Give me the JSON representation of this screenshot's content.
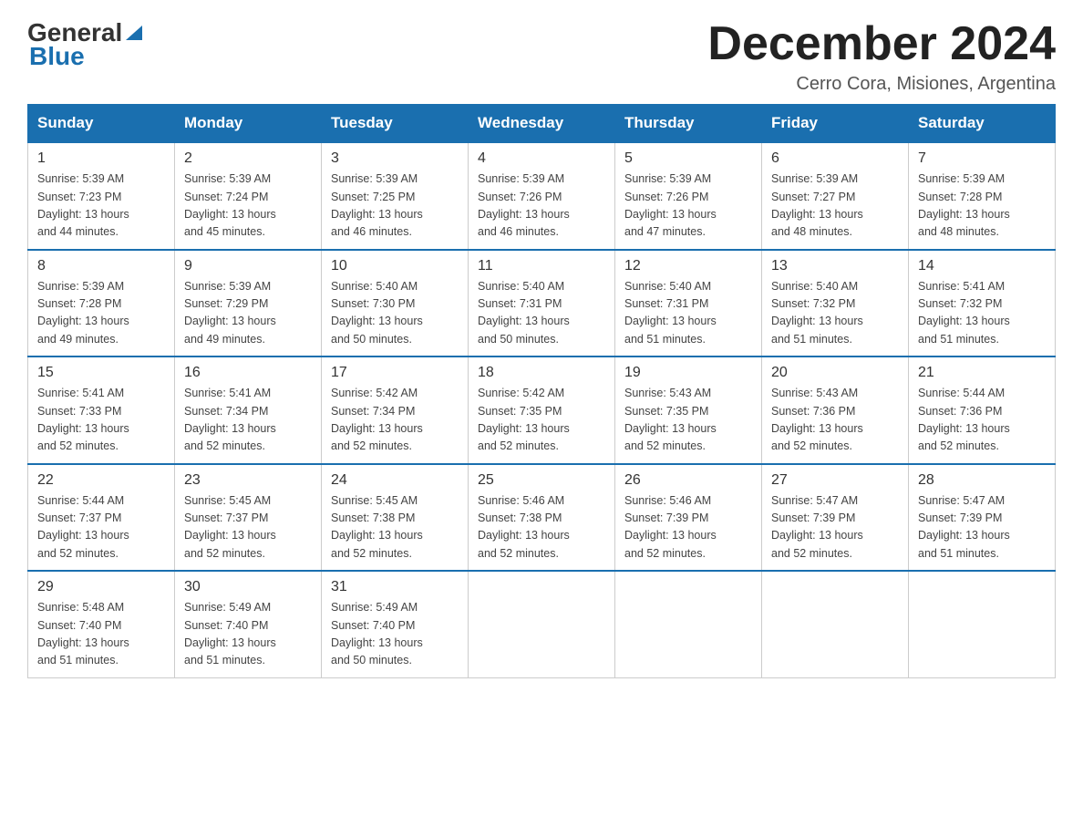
{
  "header": {
    "logo_general": "General",
    "logo_blue": "Blue",
    "title": "December 2024",
    "subtitle": "Cerro Cora, Misiones, Argentina"
  },
  "days_of_week": [
    "Sunday",
    "Monday",
    "Tuesday",
    "Wednesday",
    "Thursday",
    "Friday",
    "Saturday"
  ],
  "weeks": [
    [
      {
        "day": "1",
        "sunrise": "5:39 AM",
        "sunset": "7:23 PM",
        "daylight": "13 hours and 44 minutes."
      },
      {
        "day": "2",
        "sunrise": "5:39 AM",
        "sunset": "7:24 PM",
        "daylight": "13 hours and 45 minutes."
      },
      {
        "day": "3",
        "sunrise": "5:39 AM",
        "sunset": "7:25 PM",
        "daylight": "13 hours and 46 minutes."
      },
      {
        "day": "4",
        "sunrise": "5:39 AM",
        "sunset": "7:26 PM",
        "daylight": "13 hours and 46 minutes."
      },
      {
        "day": "5",
        "sunrise": "5:39 AM",
        "sunset": "7:26 PM",
        "daylight": "13 hours and 47 minutes."
      },
      {
        "day": "6",
        "sunrise": "5:39 AM",
        "sunset": "7:27 PM",
        "daylight": "13 hours and 48 minutes."
      },
      {
        "day": "7",
        "sunrise": "5:39 AM",
        "sunset": "7:28 PM",
        "daylight": "13 hours and 48 minutes."
      }
    ],
    [
      {
        "day": "8",
        "sunrise": "5:39 AM",
        "sunset": "7:28 PM",
        "daylight": "13 hours and 49 minutes."
      },
      {
        "day": "9",
        "sunrise": "5:39 AM",
        "sunset": "7:29 PM",
        "daylight": "13 hours and 49 minutes."
      },
      {
        "day": "10",
        "sunrise": "5:40 AM",
        "sunset": "7:30 PM",
        "daylight": "13 hours and 50 minutes."
      },
      {
        "day": "11",
        "sunrise": "5:40 AM",
        "sunset": "7:31 PM",
        "daylight": "13 hours and 50 minutes."
      },
      {
        "day": "12",
        "sunrise": "5:40 AM",
        "sunset": "7:31 PM",
        "daylight": "13 hours and 51 minutes."
      },
      {
        "day": "13",
        "sunrise": "5:40 AM",
        "sunset": "7:32 PM",
        "daylight": "13 hours and 51 minutes."
      },
      {
        "day": "14",
        "sunrise": "5:41 AM",
        "sunset": "7:32 PM",
        "daylight": "13 hours and 51 minutes."
      }
    ],
    [
      {
        "day": "15",
        "sunrise": "5:41 AM",
        "sunset": "7:33 PM",
        "daylight": "13 hours and 52 minutes."
      },
      {
        "day": "16",
        "sunrise": "5:41 AM",
        "sunset": "7:34 PM",
        "daylight": "13 hours and 52 minutes."
      },
      {
        "day": "17",
        "sunrise": "5:42 AM",
        "sunset": "7:34 PM",
        "daylight": "13 hours and 52 minutes."
      },
      {
        "day": "18",
        "sunrise": "5:42 AM",
        "sunset": "7:35 PM",
        "daylight": "13 hours and 52 minutes."
      },
      {
        "day": "19",
        "sunrise": "5:43 AM",
        "sunset": "7:35 PM",
        "daylight": "13 hours and 52 minutes."
      },
      {
        "day": "20",
        "sunrise": "5:43 AM",
        "sunset": "7:36 PM",
        "daylight": "13 hours and 52 minutes."
      },
      {
        "day": "21",
        "sunrise": "5:44 AM",
        "sunset": "7:36 PM",
        "daylight": "13 hours and 52 minutes."
      }
    ],
    [
      {
        "day": "22",
        "sunrise": "5:44 AM",
        "sunset": "7:37 PM",
        "daylight": "13 hours and 52 minutes."
      },
      {
        "day": "23",
        "sunrise": "5:45 AM",
        "sunset": "7:37 PM",
        "daylight": "13 hours and 52 minutes."
      },
      {
        "day": "24",
        "sunrise": "5:45 AM",
        "sunset": "7:38 PM",
        "daylight": "13 hours and 52 minutes."
      },
      {
        "day": "25",
        "sunrise": "5:46 AM",
        "sunset": "7:38 PM",
        "daylight": "13 hours and 52 minutes."
      },
      {
        "day": "26",
        "sunrise": "5:46 AM",
        "sunset": "7:39 PM",
        "daylight": "13 hours and 52 minutes."
      },
      {
        "day": "27",
        "sunrise": "5:47 AM",
        "sunset": "7:39 PM",
        "daylight": "13 hours and 52 minutes."
      },
      {
        "day": "28",
        "sunrise": "5:47 AM",
        "sunset": "7:39 PM",
        "daylight": "13 hours and 51 minutes."
      }
    ],
    [
      {
        "day": "29",
        "sunrise": "5:48 AM",
        "sunset": "7:40 PM",
        "daylight": "13 hours and 51 minutes."
      },
      {
        "day": "30",
        "sunrise": "5:49 AM",
        "sunset": "7:40 PM",
        "daylight": "13 hours and 51 minutes."
      },
      {
        "day": "31",
        "sunrise": "5:49 AM",
        "sunset": "7:40 PM",
        "daylight": "13 hours and 50 minutes."
      },
      null,
      null,
      null,
      null
    ]
  ],
  "labels": {
    "sunrise": "Sunrise:",
    "sunset": "Sunset:",
    "daylight": "Daylight:"
  }
}
